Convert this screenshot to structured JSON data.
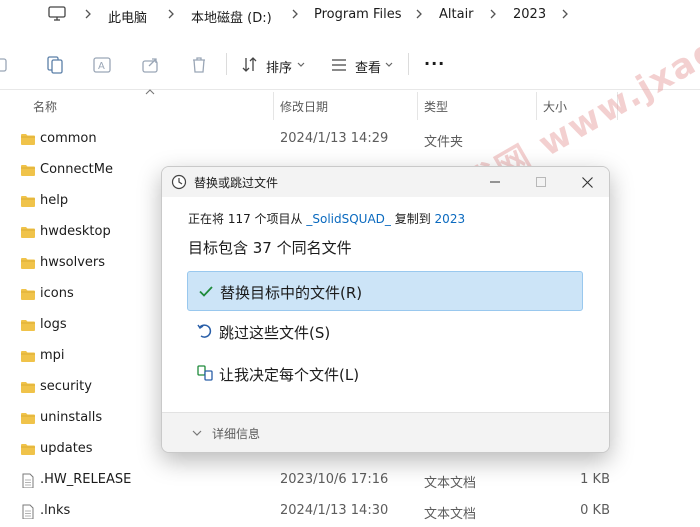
{
  "address": {
    "crumbs": [
      "此电脑",
      "本地磁盘 (D:)",
      "Program Files",
      "Altair",
      "2023"
    ]
  },
  "commandbar": {
    "sort_label": "排序",
    "view_label": "查看",
    "more_label": "···"
  },
  "columns": {
    "name": "名称",
    "date": "修改日期",
    "type": "类型",
    "size": "大小"
  },
  "files": [
    {
      "name": "common",
      "date": "2024/1/13 14:29",
      "type": "文件夹",
      "size": "",
      "kind": "folder"
    },
    {
      "name": "ConnectMe",
      "date": "",
      "type": "",
      "size": "",
      "kind": "folder"
    },
    {
      "name": "help",
      "date": "",
      "type": "",
      "size": "",
      "kind": "folder"
    },
    {
      "name": "hwdesktop",
      "date": "",
      "type": "",
      "size": "",
      "kind": "folder"
    },
    {
      "name": "hwsolvers",
      "date": "",
      "type": "",
      "size": "",
      "kind": "folder"
    },
    {
      "name": "icons",
      "date": "",
      "type": "",
      "size": "",
      "kind": "folder"
    },
    {
      "name": "logs",
      "date": "",
      "type": "",
      "size": "",
      "kind": "folder"
    },
    {
      "name": "mpi",
      "date": "",
      "type": "",
      "size": "",
      "kind": "folder"
    },
    {
      "name": "security",
      "date": "",
      "type": "",
      "size": "",
      "kind": "folder"
    },
    {
      "name": "uninstalls",
      "date": "",
      "type": "",
      "size": "",
      "kind": "folder"
    },
    {
      "name": "updates",
      "date": "",
      "type": "",
      "size": "",
      "kind": "folder"
    },
    {
      "name": ".HW_RELEASE",
      "date": "2023/10/6 17:16",
      "type": "文本文档",
      "size": "1 KB",
      "kind": "file"
    },
    {
      "name": ".lnks",
      "date": "2024/1/13 14:30",
      "type": "文本文档",
      "size": "0 KB",
      "kind": "file"
    }
  ],
  "dialog": {
    "title": "替换或跳过文件",
    "line1": {
      "prefix": "正在将 117 个项目从 ",
      "source": "_SolidSQUAD_",
      "middle": " 复制到 ",
      "dest": "2023"
    },
    "line2": "目标包含 37 个同名文件",
    "options": [
      {
        "label": "替换目标中的文件(R)",
        "icon": "check-icon",
        "selected": true
      },
      {
        "label": "跳过这些文件(S)",
        "icon": "skip-icon",
        "selected": false
      },
      {
        "label": "让我决定每个文件(L)",
        "icon": "decide-icon",
        "selected": false
      }
    ],
    "details_label": "详细信息"
  },
  "watermark": "软件时代网 www.jxage.com",
  "colors": {
    "folder": "#f0c34a",
    "link": "#0b6abf",
    "selected_bg": "#cce4f7",
    "check": "#1e8a3a"
  }
}
